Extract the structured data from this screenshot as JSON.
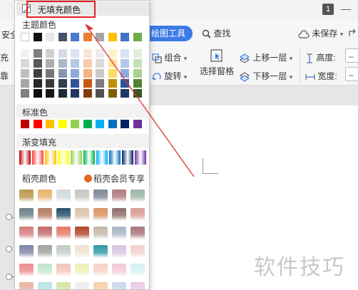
{
  "window": {
    "badge_text": "1"
  },
  "ribbon": {
    "left_cut_label_1": "安全",
    "left_cut_label_2": "充",
    "left_cut_label_3": "靠",
    "drawing_tools_tab": "绘图工具",
    "find_label": "查找",
    "unsaved_label": "未保存",
    "group_label": "组合",
    "rotate_label": "旋转",
    "selection_pane_label": "选择窗格",
    "bring_forward_label": "上移一层",
    "send_backward_label": "下移一层",
    "height_label": "高度:",
    "width_label": "宽度:"
  },
  "fill_menu": {
    "no_fill_label": "无填充颜色",
    "theme_colors_title": "主题颜色",
    "theme_top_row": [
      "#ffffff",
      "#111111",
      "#e8e8e8",
      "#44546a",
      "#4a7bd1",
      "#ed7d31",
      "#a5a5a5",
      "#ffc000",
      "#4472c4",
      "#70ad47"
    ],
    "theme_tint_columns": [
      [
        "#f2f2f2",
        "#d9d9d9",
        "#bfbfbf",
        "#a6a6a6",
        "#808080"
      ],
      [
        "#808080",
        "#595959",
        "#404040",
        "#262626",
        "#0d0d0d"
      ],
      [
        "#d0d0d0",
        "#aeaeae",
        "#757575",
        "#3a3a3a",
        "#171717"
      ],
      [
        "#d6dce5",
        "#adb9ca",
        "#8497b0",
        "#333f50",
        "#222a35"
      ],
      [
        "#dae3f3",
        "#b4c7e7",
        "#8faadc",
        "#2f5597",
        "#1f3864"
      ],
      [
        "#fbe5d6",
        "#f8cbad",
        "#f4b183",
        "#c55a11",
        "#843c0c"
      ],
      [
        "#ededed",
        "#dbdbdb",
        "#c9c9c9",
        "#7b7b7b",
        "#525252"
      ],
      [
        "#fff2cc",
        "#ffe699",
        "#ffd966",
        "#bf9000",
        "#7f6000"
      ],
      [
        "#dae3f3",
        "#b4c7e7",
        "#8faadc",
        "#2f5597",
        "#1f3864"
      ],
      [
        "#e2f0d9",
        "#c5e0b4",
        "#a9d18e",
        "#548235",
        "#385723"
      ]
    ],
    "standard_colors_title": "标准色",
    "standard_colors": [
      "#c00000",
      "#ff0000",
      "#ffc000",
      "#ffff00",
      "#92d050",
      "#00b050",
      "#00b0f0",
      "#0070c0",
      "#002060",
      "#7030a0"
    ],
    "gradient_fill_title": "渐变填充",
    "gradient_colors": [
      "#c00000",
      "#ff3b3b",
      "#ffc000",
      "#ffff00",
      "#92d050",
      "#00b050",
      "#00b0f0",
      "#0070c0",
      "#002060",
      "#7030a0"
    ],
    "docer_colors_title": "稻壳颜色",
    "docer_vip_label": "稻壳会员专享",
    "docer_tiles": [
      [
        "#b9974c",
        "#e6b36a",
        "#cfd9d6",
        "#c5c7bd",
        "#7d8798",
        "#b27a7a",
        "#9ab7a5"
      ],
      [
        "#6d7f86",
        "#b57c5f",
        "#25506b",
        "#dcc2a7",
        "#d99464",
        "#8f6e6b",
        "#d89c93"
      ],
      [
        "#d47d7d",
        "#c26a6a",
        "#e77a63",
        "#b5452a",
        "#c3b6a7",
        "#a8b4c6",
        "#a8747a"
      ],
      [
        "#7e86a3",
        "#9fa3a1",
        "#c3cbc6",
        "#efe3cf",
        "#2e9aa6",
        "#d8c3e3",
        "#f3d0cc"
      ],
      [
        "#ec8c8c",
        "#bfe6c9",
        "#f3c4bd",
        "#f1efb5",
        "#f6d2c6",
        "#f4c7d7",
        "#d6f0f3"
      ],
      [
        "#e8b2a2",
        "#b4e3e6",
        "#d4e4a8",
        "#eeeeee",
        "#f5cfa4",
        "#c8d8f0",
        "#e9c9e6"
      ]
    ]
  },
  "document": {
    "watermark_text": "软件技巧"
  }
}
